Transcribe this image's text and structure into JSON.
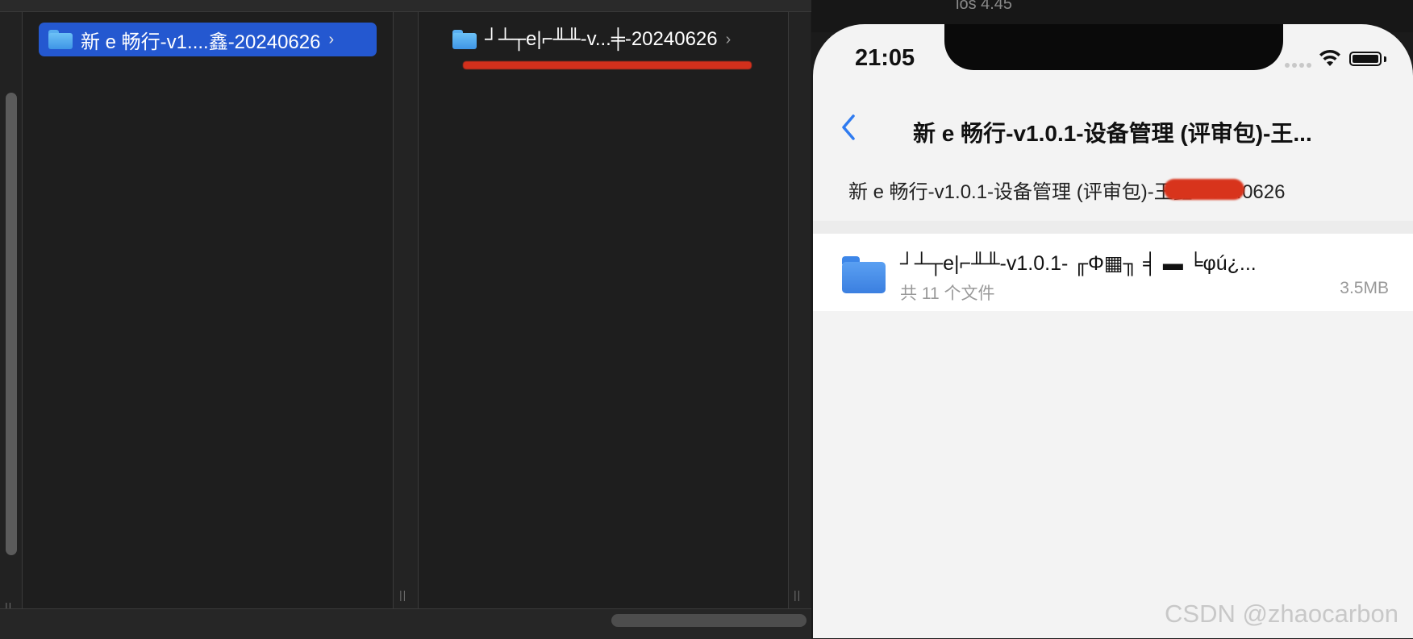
{
  "finder": {
    "column1_selected_label": "新 e 畅行-v1....鑫-20240626",
    "column2_item_label": "┘┴┬e|⌐╨╨-v...╪-20240626"
  },
  "phone": {
    "top_partial_text": "ios 4.45",
    "status": {
      "time": "21:05"
    },
    "nav": {
      "title": "新 e 畅行-v1.0.1-设备管理 (评审包)-王..."
    },
    "breadcrumb": {
      "text": "新 e 畅行-v1.0.1-设备管理 (评审包)-王鑫-20240626"
    },
    "file": {
      "name": "┘┴┬e|⌐╨╨-v1.0.1- ╓Φ▦╖ ╡ ▬ ╘φú¿...",
      "count": "共 11 个文件",
      "size": "3.5MB"
    }
  },
  "watermark": "CSDN @zhaocarbon",
  "colors": {
    "finder_bg": "#1e1e1e",
    "selection": "#2458d0",
    "folder_blue": "#4a9ae8",
    "phone_bg": "#f3f3f3",
    "ios_blue": "#2f7bf0",
    "redaction": "#d3301c"
  },
  "icons": [
    "folder-icon",
    "chevron-right-icon",
    "back-chevron-icon",
    "wifi-icon",
    "battery-icon",
    "signal-icon"
  ]
}
